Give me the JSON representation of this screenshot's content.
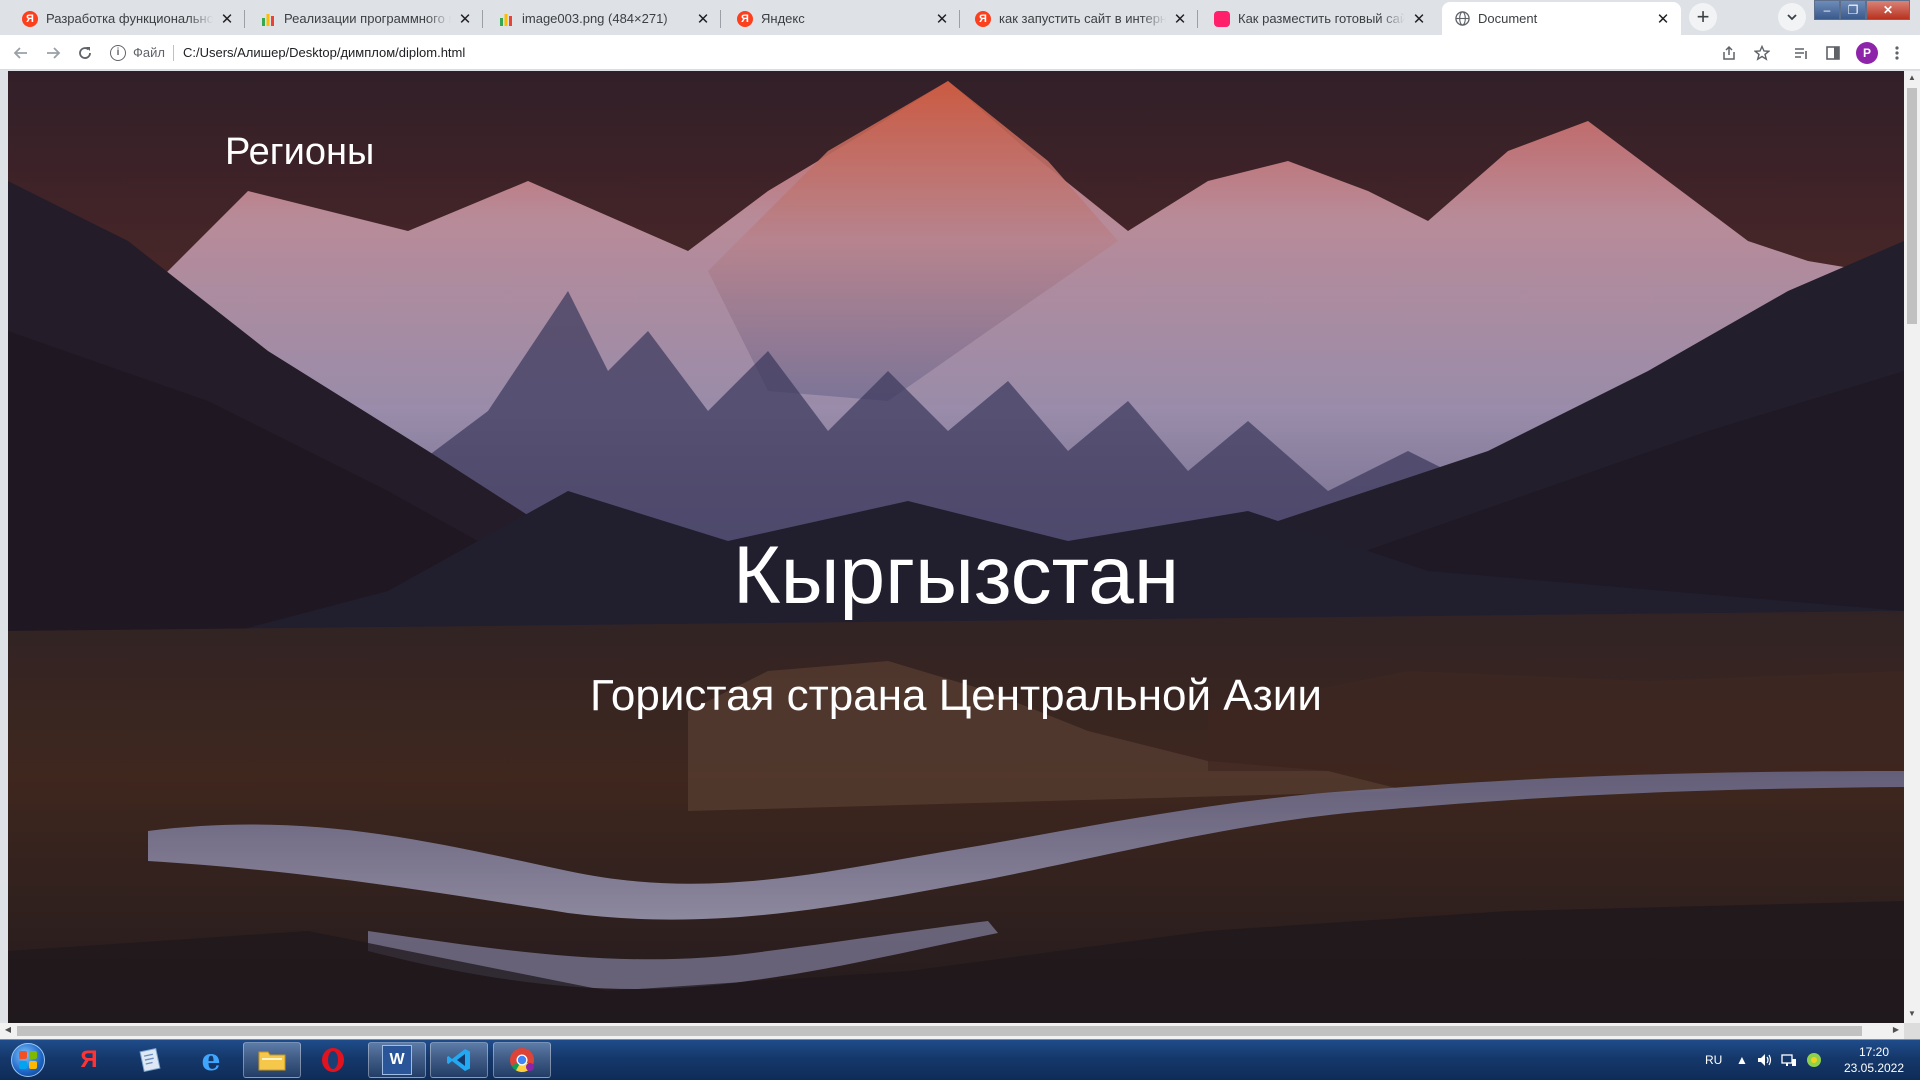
{
  "browser": {
    "tabs": [
      {
        "title": "Разработка функциональной схе",
        "icon": "yandex-icon",
        "active": false
      },
      {
        "title": "Реализации программного продукта",
        "icon": "chart-icon",
        "active": false
      },
      {
        "title": "image003.png (484×271)",
        "icon": "chart-icon",
        "active": false
      },
      {
        "title": "Яндекс",
        "icon": "yandex-icon",
        "active": false
      },
      {
        "title": "как запустить сайт в интернете —",
        "icon": "yandex-icon",
        "active": false
      },
      {
        "title": "Как разместить готовый сайт в Ин",
        "icon": "pink-logo-icon",
        "active": false
      },
      {
        "title": "Document",
        "icon": "globe-icon",
        "active": true
      }
    ],
    "omnibox": {
      "scheme": "Файл",
      "url": "C:/Users/Алишер/Desktop/димплом/diplom.html"
    },
    "profile_initial": "P"
  },
  "page": {
    "nav_link": "Регионы",
    "title": "Кыргызстан",
    "subtitle": "Гористая страна Центральной Азии"
  },
  "taskbar": {
    "apps": [
      {
        "name": "yandex-browser",
        "glyph": "Я",
        "running": false
      },
      {
        "name": "notepad",
        "glyph": "",
        "running": false
      },
      {
        "name": "internet-explorer",
        "glyph": "e",
        "running": false
      },
      {
        "name": "explorer",
        "glyph": "",
        "running": true
      },
      {
        "name": "opera",
        "glyph": "O",
        "running": false
      },
      {
        "name": "word",
        "glyph": "W",
        "running": true
      },
      {
        "name": "vscode",
        "glyph": "",
        "running": true
      },
      {
        "name": "chrome",
        "glyph": "",
        "running": true
      }
    ],
    "lang": "RU",
    "time": "17:20",
    "date": "23.05.2022"
  }
}
